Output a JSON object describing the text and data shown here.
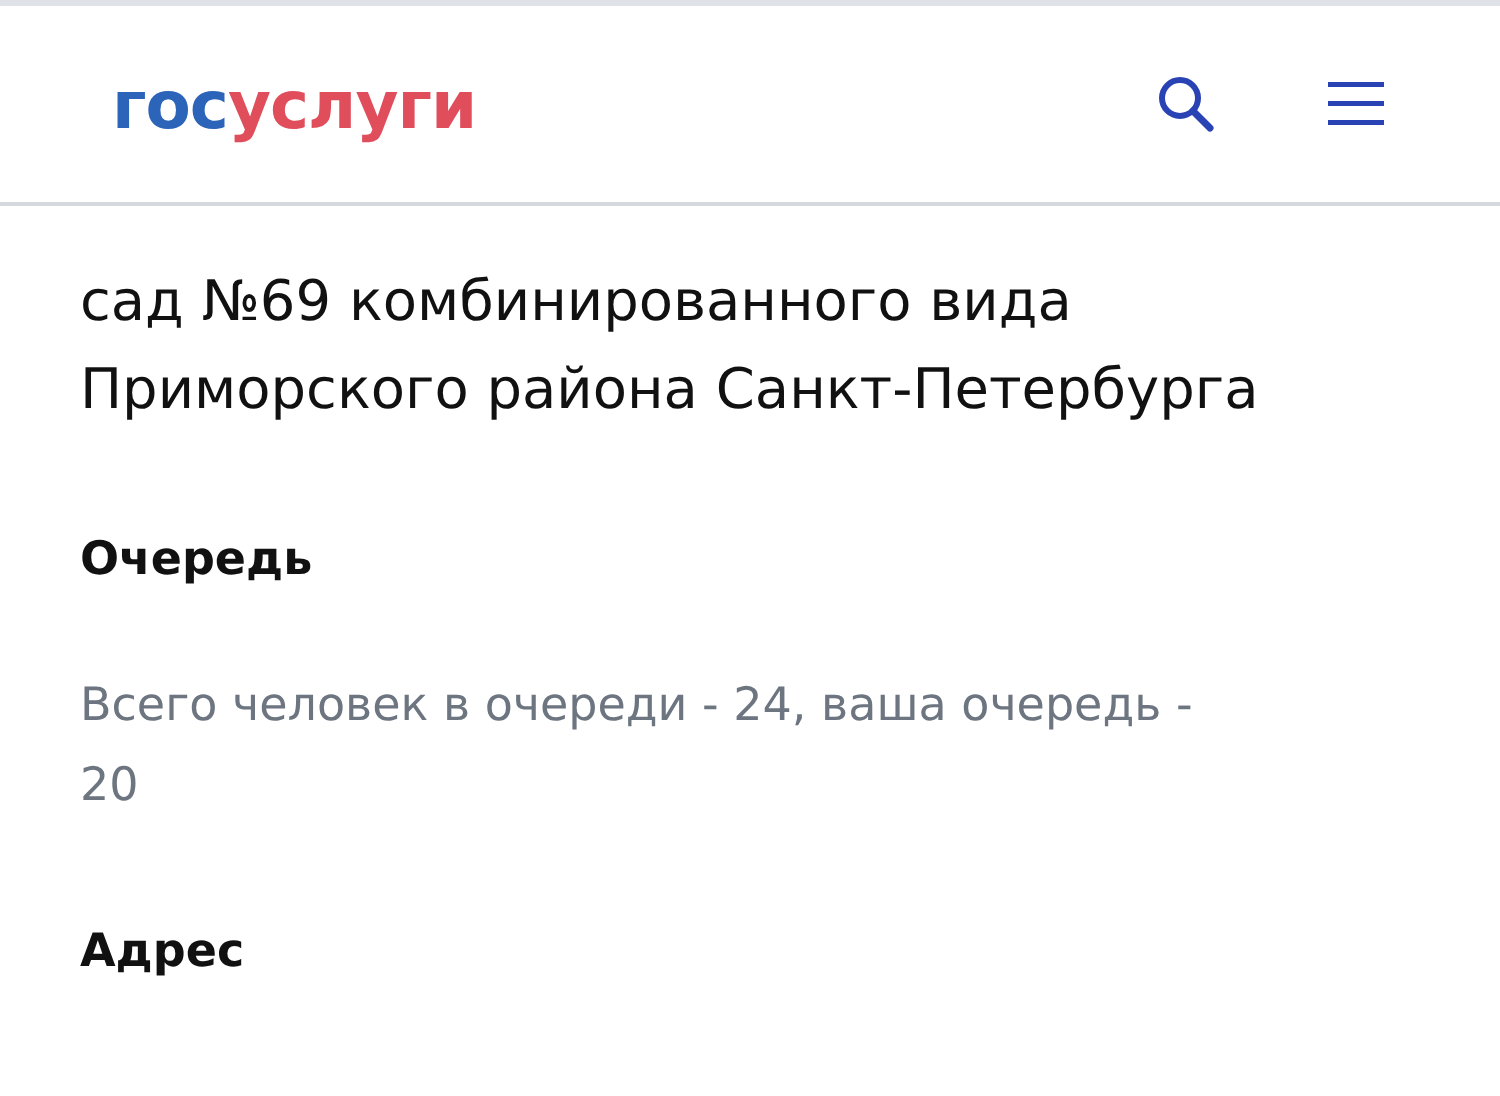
{
  "header": {
    "logo": {
      "part_1": "гос",
      "part_2": "услуги"
    }
  },
  "organization": {
    "name_lines": [
      "сад №69 комбинированного вида",
      "Приморского района Санкт-Петербурга"
    ]
  },
  "sections": [
    {
      "title": "Очередь",
      "text": "Всего человек в очереди - 24, ваша очередь - 20"
    },
    {
      "title": "Адрес"
    }
  ]
}
